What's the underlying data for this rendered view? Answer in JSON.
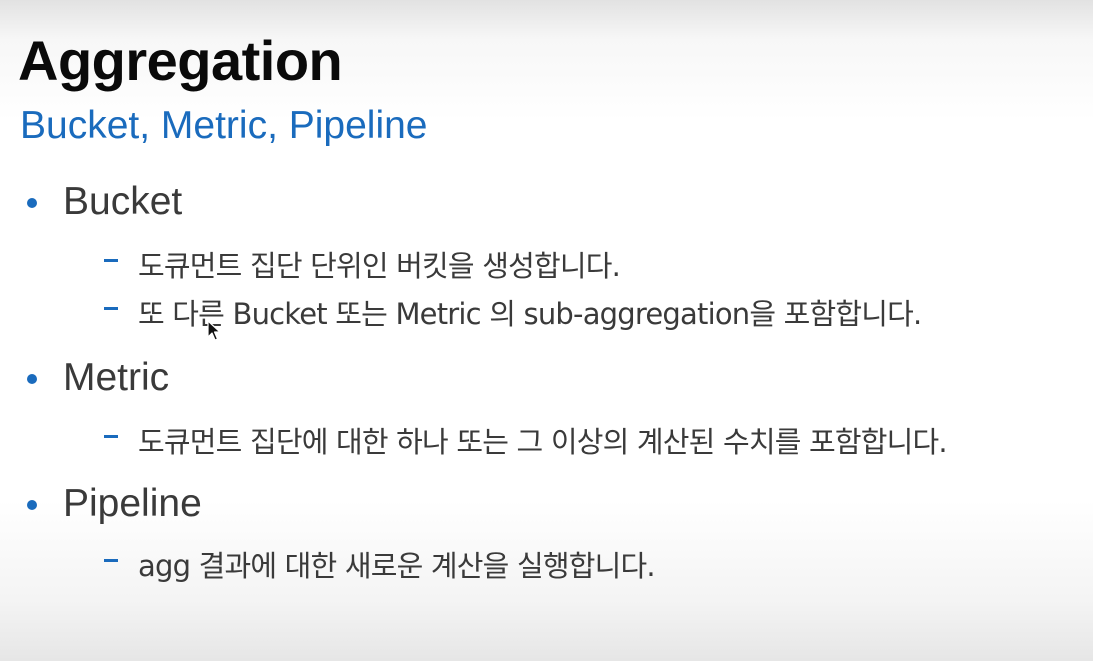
{
  "slide": {
    "title": "Aggregation",
    "subtitle": "Bucket, Metric, Pipeline",
    "sections": [
      {
        "label": "Bucket",
        "items": [
          "도큐먼트 집단 단위인 버킷을 생성합니다.",
          "또 다른 Bucket 또는 Metric 의 sub-aggregation을 포함합니다."
        ]
      },
      {
        "label": "Metric",
        "items": [
          "도큐먼트 집단에 대한 하나 또는 그 이상의 계산된 수치를 포함합니다."
        ]
      },
      {
        "label": "Pipeline",
        "items": [
          "agg 결과에 대한 새로운 계산을 실행합니다."
        ]
      }
    ],
    "colors": {
      "accent": "#1a6bbd",
      "title": "#0a0a0a",
      "body": "#3a3a3a"
    },
    "icons": {
      "cursor": "mouse-pointer-icon",
      "bullet": "bullet-dot-icon",
      "dash": "dash-bullet-icon"
    }
  }
}
